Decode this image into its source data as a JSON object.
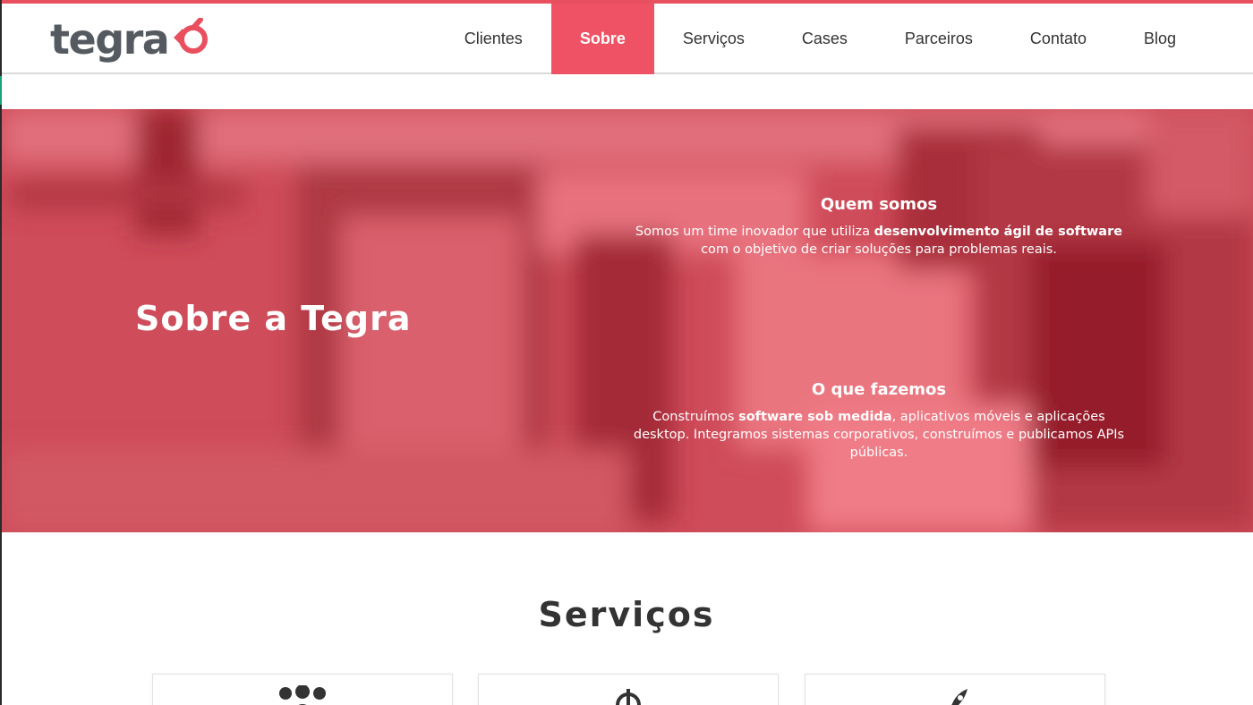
{
  "brand": {
    "logo_text": "tegra",
    "accent_color": "#ef5264",
    "text_color": "#555a60"
  },
  "nav": {
    "items": [
      {
        "label": "Clientes"
      },
      {
        "label": "Sobre",
        "active": true
      },
      {
        "label": "Serviços"
      },
      {
        "label": "Cases"
      },
      {
        "label": "Parceiros"
      },
      {
        "label": "Contato"
      },
      {
        "label": "Blog"
      }
    ]
  },
  "hero": {
    "title": "Sobre a Tegra",
    "overlay_color": "#d9505e",
    "quem_somos": {
      "heading": "Quem somos",
      "text_before": "Somos um time inovador que utiliza ",
      "text_bold": "desenvolvimento ágil de software",
      "text_after": " com o objetivo de criar soluções para problemas reais."
    },
    "o_que_fazemos": {
      "heading": "O que fazemos",
      "text_before": "Construímos ",
      "text_bold": "software sob medida",
      "text_after": ", aplicativos móveis e aplicações desktop. Integramos sistemas corporativos, construímos e publicamos APIs públicas."
    }
  },
  "services": {
    "title": "Serviços",
    "cards": [
      {
        "icon": "team-icon"
      },
      {
        "icon": "process-icon"
      },
      {
        "icon": "rocket-icon"
      }
    ]
  }
}
